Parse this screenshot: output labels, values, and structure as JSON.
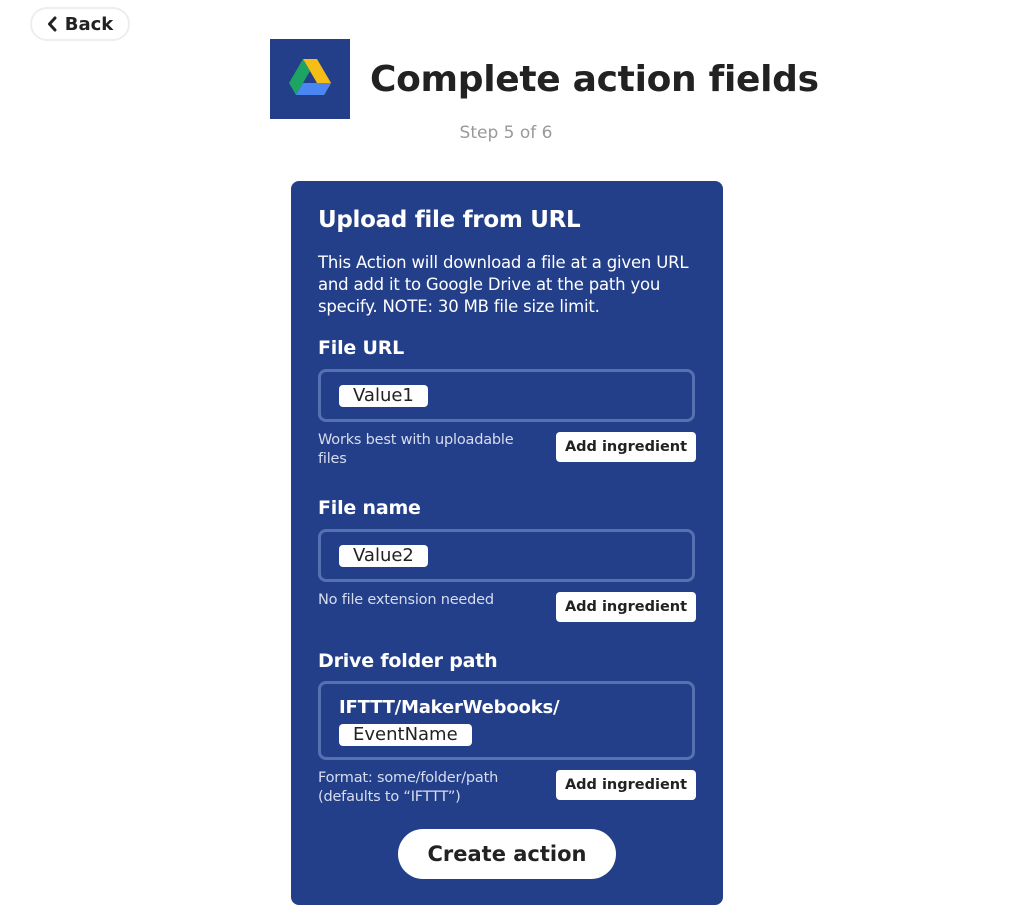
{
  "nav": {
    "back_label": "Back"
  },
  "header": {
    "title": "Complete action fields",
    "step": "Step 5 of 6",
    "service_icon": "google-drive-icon"
  },
  "action": {
    "title": "Upload file from URL",
    "description": "This Action will download a file at a given URL and add it to Google Drive at the path you specify. NOTE: 30 MB file size limit."
  },
  "fields": {
    "file_url": {
      "label": "File URL",
      "ingredient": "Value1",
      "helper": "Works best with uploadable files",
      "button": "Add ingredient"
    },
    "file_name": {
      "label": "File name",
      "ingredient": "Value2",
      "helper": "No file extension needed",
      "button": "Add ingredient"
    },
    "folder_path": {
      "label": "Drive folder path",
      "text": "IFTTT/MakerWebooks/",
      "ingredient": "EventName",
      "helper": "Format: some/folder/path (defaults to “IFTTT”)",
      "button": "Add ingredient"
    }
  },
  "submit_label": "Create action",
  "colors": {
    "card_background": "#233f89",
    "input_border": "#5770b1",
    "text_dark": "#222222",
    "muted_text": "#999999"
  }
}
